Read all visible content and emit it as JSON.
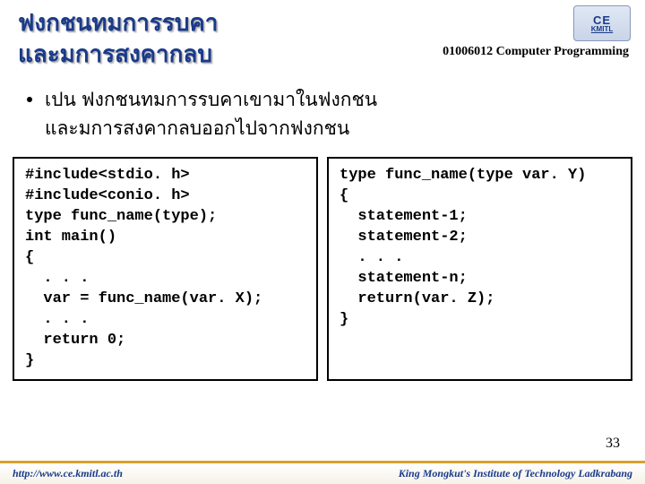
{
  "title": {
    "line1": "ฟงกชนทมการรบคา",
    "line2": "และมการสงคากลบ"
  },
  "course": "01006012 Computer Programming",
  "logo": {
    "top": "CE",
    "bot": "KMITL"
  },
  "bullet": {
    "line1": "เปน   ฟงกชนทมการรบคาเขามาในฟงกชน",
    "line2": "และมการสงคากลบออกไปจากฟงกชน"
  },
  "code_left": "#include<stdio. h>\n#include<conio. h>\ntype func_name(type);\nint main()\n{\n  . . .\n  var = func_name(var. X);\n  . . .\n  return 0;\n}",
  "code_right": "type func_name(type var. Y)\n{\n  statement-1;\n  statement-2;\n  . . .\n  statement-n;\n  return(var. Z);\n}",
  "page_number": "33",
  "footer": {
    "left": "http://www.ce.kmitl.ac.th",
    "right": "King Mongkut's Institute of Technology Ladkrabang"
  }
}
